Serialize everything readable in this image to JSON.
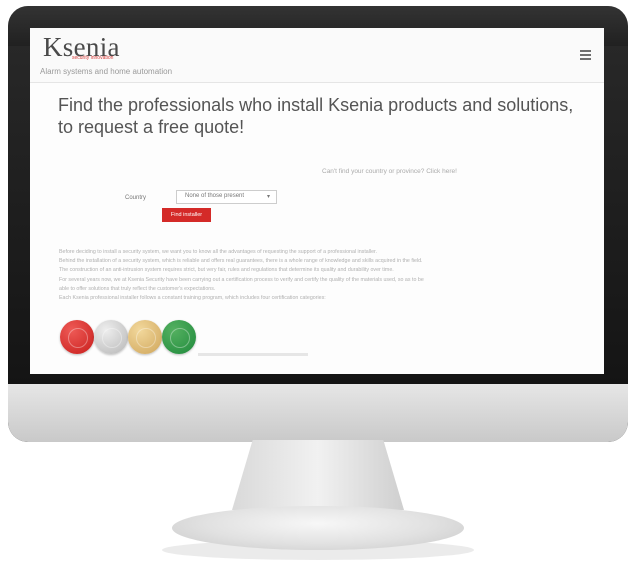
{
  "header": {
    "logo_text": "Ksenia",
    "logo_subline": "security innovation",
    "tagline": "Alarm systems and home automation"
  },
  "main": {
    "headline": "Find the professionals who install Ksenia products and solutions, to request a free quote!",
    "cant_find_link": "Can't find your country or province? Click here!",
    "country_label": "Country",
    "country_select_value": "None of those present",
    "find_button_label": "Find installer",
    "body_lines": [
      "Before deciding to install a security system, we want you to know all the advantages of requesting the support of a professional installer.",
      "Behind the installation of a security system, which is reliable and offers real guarantees, there is a whole range of knowledge and skills acquired in the field.",
      "The construction of an anti-intrusion system requires strict, but very fair, rules and regulations that determine its quality and durability over time.",
      "For several years now, we at Ksenia Security have been carrying out a certification process to verify and certify the quality of the materials used, so as to be",
      "able to offer solutions that truly reflect the customer's expectations.",
      "Each Ksenia professional installer follows a constant training program, which includes four certification categories:"
    ]
  },
  "colors": {
    "accent_red": "#d42a28",
    "medal_red": "#c81d1b",
    "medal_silver": "#b6b6b6",
    "medal_gold": "#cfa55a",
    "medal_green": "#1f8a3c"
  },
  "icons": {
    "menu": "hamburger-menu-icon",
    "select_arrow": "chevron-down-icon"
  }
}
